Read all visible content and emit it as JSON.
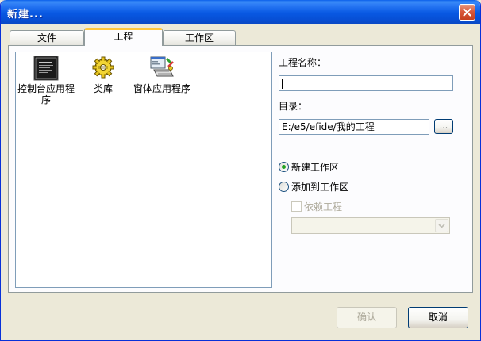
{
  "window": {
    "title": "新建..."
  },
  "tabs": [
    {
      "label": "文件"
    },
    {
      "label": "工程"
    },
    {
      "label": "工作区"
    }
  ],
  "project_types": [
    {
      "label": "控制台应用程序",
      "icon": "console-app-icon"
    },
    {
      "label": "类库",
      "icon": "class-library-icon"
    },
    {
      "label": "窗体应用程序",
      "icon": "windows-app-icon"
    }
  ],
  "form": {
    "name_label": "工程名称：",
    "name_value": "",
    "dir_label": "目录：",
    "dir_value": "E:/e5/efide/我的工程",
    "browse_label": "...",
    "radio_new_workspace": "新建工作区",
    "radio_add_workspace": "添加到工作区",
    "depend_label": "依赖工程",
    "depend_select_value": ""
  },
  "buttons": {
    "ok": "确认",
    "cancel": "取消"
  },
  "colors": {
    "titlebar": "#0858E3",
    "panel": "#ECE9D8",
    "active_tab_accent": "#FFC73C",
    "radio_dot": "#21A121",
    "disabled_text": "#ACA899"
  }
}
